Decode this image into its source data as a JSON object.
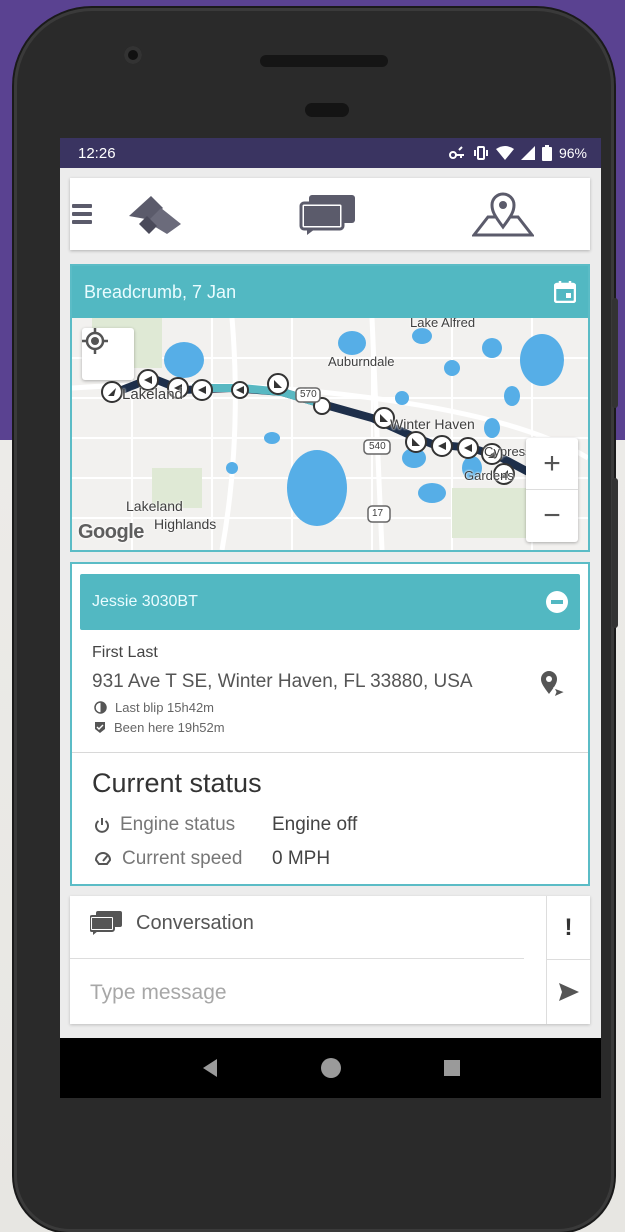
{
  "status_bar": {
    "time": "12:26",
    "battery": "96%",
    "icons": [
      "key-icon",
      "vibrate-icon",
      "wifi-icon",
      "signal-icon",
      "battery-icon"
    ]
  },
  "app_bar": {
    "icons": [
      "menu-icon",
      "fleet-logo-icon",
      "messages-icon",
      "map-pin-icon"
    ]
  },
  "map_card": {
    "title": "Breadcrumb, 7 Jan",
    "labels": {
      "lake_alfred": "Lake Alfred",
      "auburndale": "Auburndale",
      "lakeland": "Lakeland",
      "winter_haven": "Winter Haven",
      "cypress": "Cypress",
      "gardens": "Gardens",
      "lakeland_highlands_1": "Lakeland",
      "lakeland_highlands_2": "Highlands",
      "route_570": "570",
      "route_540": "540",
      "route_17": "17"
    },
    "attribution": "Google",
    "zoom_in": "+",
    "zoom_out": "−"
  },
  "device_card": {
    "name": "Jessie 3030BT",
    "owner": "First Last",
    "address": "931 Ave T SE, Winter Haven, FL 33880, USA",
    "last_blip": "Last blip 15h42m",
    "been_here": "Been here 19h52m",
    "status_title": "Current status",
    "engine_label": "Engine status",
    "engine_value": "Engine off",
    "speed_label": "Current speed",
    "speed_value": "0 MPH"
  },
  "chat": {
    "title": "Conversation",
    "placeholder": "Type message",
    "alert_label": "!"
  },
  "colors": {
    "accent": "#52b8c2",
    "status_bar": "#3a3461",
    "background_top": "#5a4291"
  }
}
